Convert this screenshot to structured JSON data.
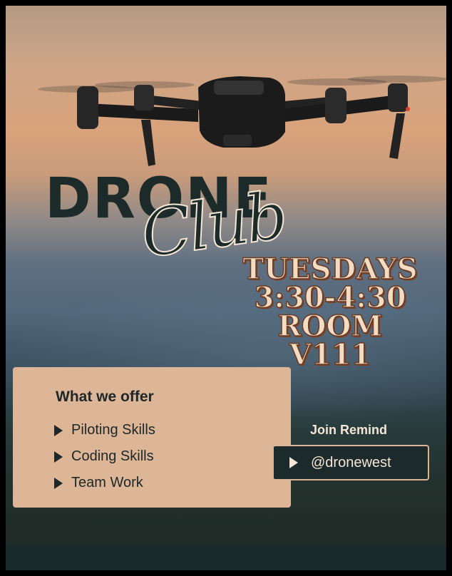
{
  "poster": {
    "title_main": "DRONE",
    "title_script": "Club",
    "schedule": [
      "TUESDAYS",
      "3:30-4:30",
      "ROOM V111"
    ]
  },
  "offer": {
    "title": "What we offer",
    "items": [
      "Piloting Skills",
      "Coding Skills",
      "Team Work"
    ]
  },
  "join": {
    "label": "Join Remind",
    "handle": "@dronewest"
  },
  "colors": {
    "dark_teal": "#1c2b2a",
    "peach": "#ddb597",
    "cream": "#f2dcc4",
    "schedule_outline": "#6b3a22"
  },
  "icons": [
    "drone-photo",
    "chevron-right-icon"
  ]
}
